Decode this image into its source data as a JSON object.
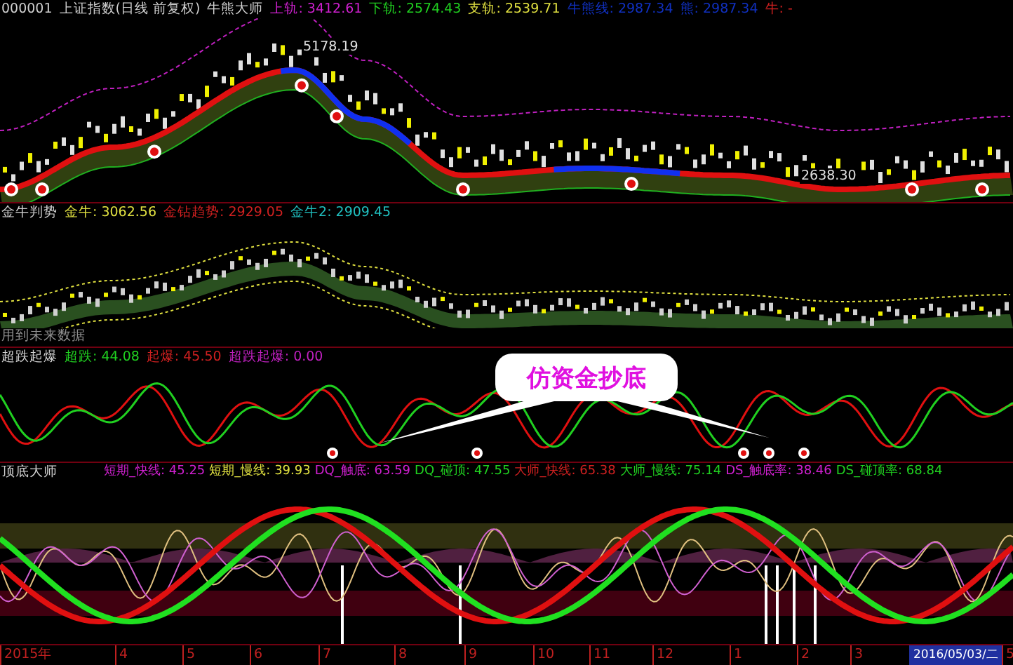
{
  "main_panel": {
    "code": "000001",
    "title": "上证指数(日线 前复权)",
    "indicator": "牛熊大师",
    "values": [
      {
        "text": "上轨: 3412.61",
        "color": "#d020d0"
      },
      {
        "text": "下轨: 2574.43",
        "color": "#20d020"
      },
      {
        "text": "支轨: 2539.71",
        "color": "#e0e040"
      },
      {
        "text": "牛熊线: 2987.34",
        "color": "#1030c0"
      },
      {
        "text": "熊: 2987.34",
        "color": "#1030c0"
      },
      {
        "text": "牛: -",
        "color": "#d02020"
      }
    ],
    "annotations": [
      "5178.19",
      "2638.30"
    ]
  },
  "trend_panel": {
    "indicator": "金牛判势",
    "values": [
      {
        "text": "金牛: 3062.56",
        "color": "#e0e040"
      },
      {
        "text": "金钻趋势: 2929.05",
        "color": "#d02020"
      },
      {
        "text": "金牛2: 2909.45",
        "color": "#20c0c0"
      }
    ],
    "note": "用到未来数据"
  },
  "burst_panel": {
    "indicator": "超跌起爆",
    "values": [
      {
        "text": "超跌: 44.08",
        "color": "#20d020"
      },
      {
        "text": "起爆: 45.50",
        "color": "#d02020"
      },
      {
        "text": "超跌起爆: 0.00",
        "color": "#c020c0"
      }
    ],
    "callout": "仿资金抄底"
  },
  "master_panel": {
    "indicator": "顶底大师",
    "values": [
      {
        "text": "短期_快线: 45.25",
        "color": "#d020d0"
      },
      {
        "text": "短期_慢线: 39.93",
        "color": "#e0e040"
      },
      {
        "text": "DQ_触底: 63.59",
        "color": "#d020d0"
      },
      {
        "text": "DQ_碰顶: 47.55",
        "color": "#20d020"
      },
      {
        "text": "大师_快线: 65.38",
        "color": "#d02020"
      },
      {
        "text": "大师_慢线: 75.14",
        "color": "#20d020"
      },
      {
        "text": "DS_触底率: 38.46",
        "color": "#d020d0"
      },
      {
        "text": "DS_碰顶率: 68.84",
        "color": "#20d020"
      }
    ]
  },
  "time_axis": [
    {
      "label": "2015年",
      "selected": false
    },
    {
      "label": "4",
      "selected": false
    },
    {
      "label": "5",
      "selected": false
    },
    {
      "label": "6",
      "selected": false
    },
    {
      "label": "7",
      "selected": false
    },
    {
      "label": "8",
      "selected": false
    },
    {
      "label": "9",
      "selected": false
    },
    {
      "label": "10",
      "selected": false
    },
    {
      "label": "11",
      "selected": false
    },
    {
      "label": "12",
      "selected": false
    },
    {
      "label": "1",
      "selected": false
    },
    {
      "label": "2",
      "selected": false
    },
    {
      "label": "3",
      "selected": false
    },
    {
      "label": "2016/05/03/二",
      "selected": true
    },
    {
      "label": "5",
      "selected": false
    }
  ]
}
